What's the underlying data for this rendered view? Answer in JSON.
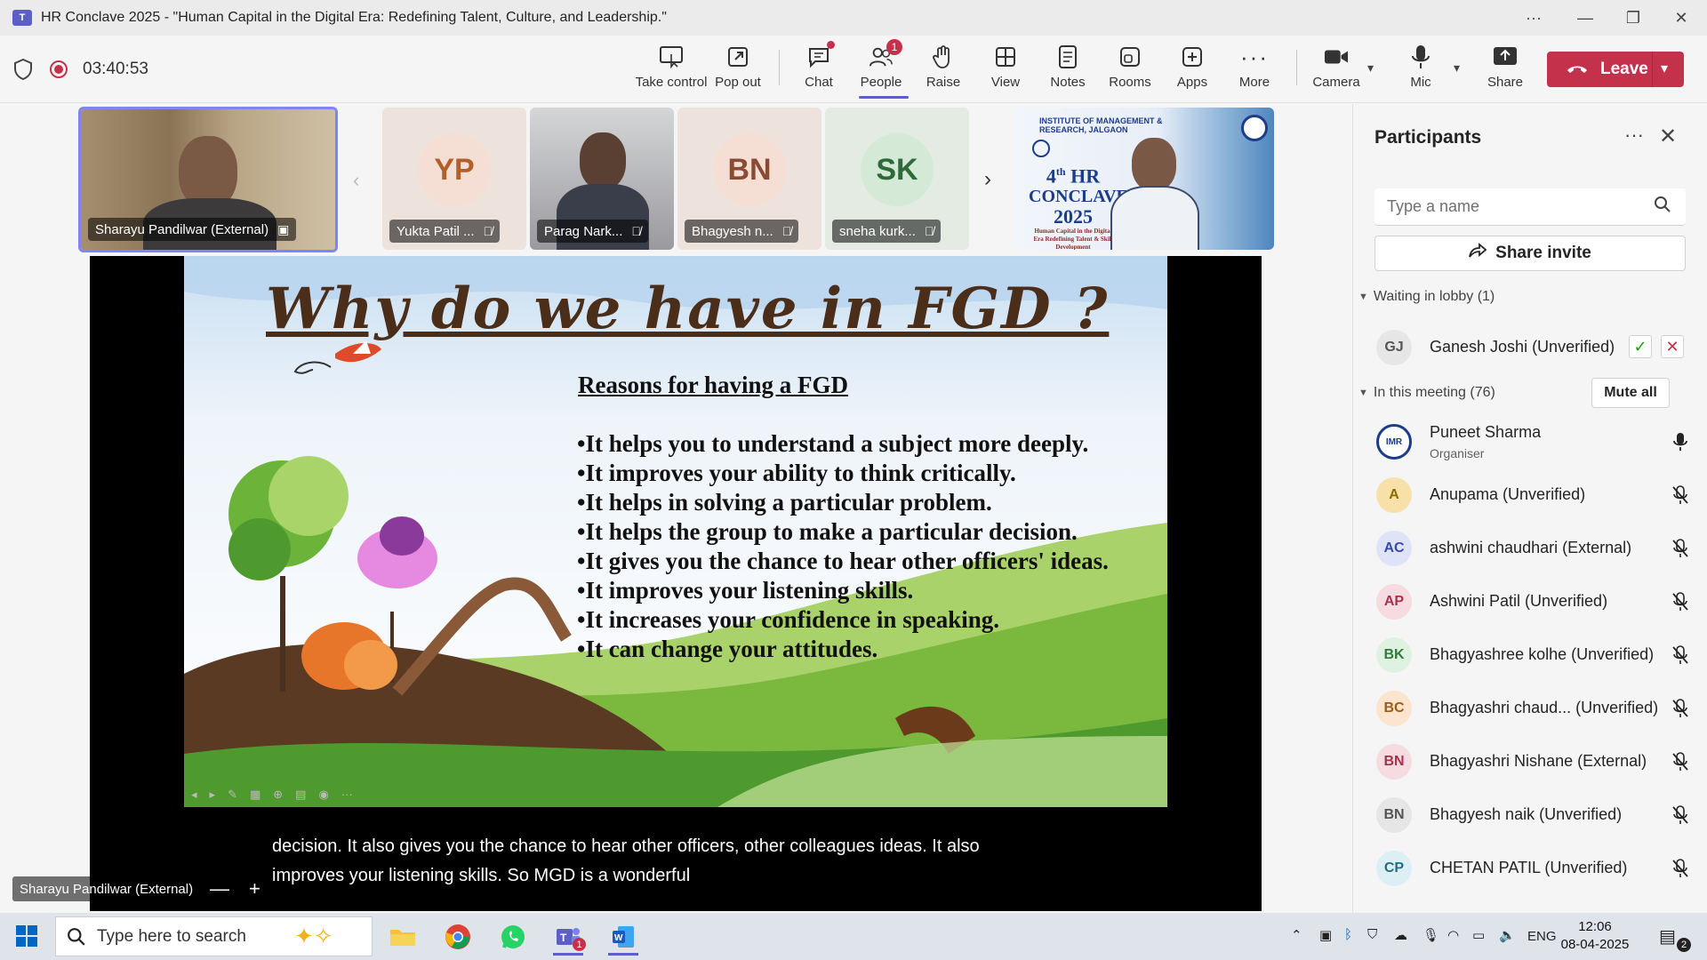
{
  "window": {
    "title": "HR Conclave 2025 - \"Human Capital in the Digital Era: Redefining Talent, Culture, and Leadership.\""
  },
  "meeting": {
    "timer": "03:40:53",
    "toolbar": [
      {
        "key": "take_control",
        "label": "Take control",
        "icon": "take-control-icon"
      },
      {
        "key": "pop_out",
        "label": "Pop out",
        "icon": "pop-out-icon"
      },
      {
        "key": "chat",
        "label": "Chat",
        "icon": "chat-icon"
      },
      {
        "key": "people",
        "label": "People",
        "icon": "people-icon",
        "badge": "1"
      },
      {
        "key": "raise",
        "label": "Raise",
        "icon": "hand-icon"
      },
      {
        "key": "view",
        "label": "View",
        "icon": "view-grid-icon"
      },
      {
        "key": "notes",
        "label": "Notes",
        "icon": "notes-icon"
      },
      {
        "key": "rooms",
        "label": "Rooms",
        "icon": "rooms-icon"
      },
      {
        "key": "apps",
        "label": "Apps",
        "icon": "apps-icon"
      },
      {
        "key": "more",
        "label": "More",
        "icon": "more-icon"
      },
      {
        "key": "camera",
        "label": "Camera",
        "icon": "camera-icon"
      },
      {
        "key": "mic",
        "label": "Mic",
        "icon": "mic-icon"
      },
      {
        "key": "share",
        "label": "Share",
        "icon": "share-icon"
      }
    ],
    "leave_label": "Leave"
  },
  "tiles": [
    {
      "name": "Sharayu Pandilwar (External)",
      "type": "video"
    },
    {
      "name": "Yukta Patil ...",
      "initials": "YP",
      "muted": true
    },
    {
      "name": "Parag Nark...",
      "type": "video",
      "muted": true
    },
    {
      "name": "Bhagyesh n...",
      "initials": "BN",
      "muted": true
    },
    {
      "name": "sneha kurk...",
      "initials": "SK",
      "muted": true
    }
  ],
  "conclave_banner": {
    "institute": "INSTITUTE OF MANAGEMENT & RESEARCH, JALGAON",
    "line1": "4",
    "line1_sup": "th",
    "line1_rest": " HR",
    "line2": "CONCLAVE",
    "line3": "2025",
    "tagline": "Human Capital in the Digital Era Redefining Talent & Skill Development"
  },
  "slide": {
    "title": "Why do we have in FGD ?",
    "subtitle": "Reasons for having a FGD",
    "bullets": [
      "•It helps you to understand a subject more deeply.",
      "•It improves your ability to think critically.",
      "•It helps in solving a particular problem.",
      "•It helps the group to make a particular decision.",
      "•It gives you the chance to hear other officers' ideas.",
      "•It improves your listening skills.",
      "•It increases your confidence in speaking.",
      "•It can change your attitudes."
    ]
  },
  "caption": {
    "line1": "decision. It also gives you the chance to hear other officers, other colleagues ideas. It also",
    "line2": "improves your listening skills. So MGD is a wonderful"
  },
  "stage": {
    "speaker_label": "Sharayu Pandilwar (External)",
    "zoom_out": "—",
    "zoom_in": "+"
  },
  "participants": {
    "title": "Participants",
    "search_placeholder": "Type a name",
    "share_invite": "Share invite",
    "lobby_label": "Waiting in lobby (1)",
    "lobby": [
      {
        "initials": "GJ",
        "name": "Ganesh Joshi (Unverified)"
      }
    ],
    "meeting_label": "In this meeting (76)",
    "mute_all": "Mute all",
    "list": [
      {
        "initials": "IMR",
        "name": "Puneet Sharma",
        "role": "Organiser",
        "mic": "on"
      },
      {
        "initials": "A",
        "name": "Anupama (Unverified)",
        "mic": "off",
        "color": "#f7e1a8",
        "fg": "#8a6d00"
      },
      {
        "initials": "AC",
        "name": "ashwini chaudhari (External)",
        "mic": "off",
        "color": "#dfe3f7",
        "fg": "#3a4aa8"
      },
      {
        "initials": "AP",
        "name": "Ashwini Patil (Unverified)",
        "mic": "off",
        "color": "#f6dbe0",
        "fg": "#a3344d"
      },
      {
        "initials": "BK",
        "name": "Bhagyashree kolhe (Unverified)",
        "mic": "off",
        "color": "#dff2e1",
        "fg": "#2e7d3a"
      },
      {
        "initials": "BC",
        "name": "Bhagyashri chaud...   (Unverified)",
        "mic": "off",
        "color": "#fbe5cf",
        "fg": "#a35a13"
      },
      {
        "initials": "BN",
        "name": "Bhagyashri Nishane (External)",
        "mic": "off",
        "color": "#f6dbe0",
        "fg": "#a3344d"
      },
      {
        "initials": "BN",
        "name": "Bhagyesh naik (Unverified)",
        "mic": "off",
        "color": "#e6e6e6",
        "fg": "#555555"
      },
      {
        "initials": "CP",
        "name": "CHETAN PATIL (Unverified)",
        "mic": "off",
        "color": "#dceff5",
        "fg": "#1f6e8a"
      }
    ]
  },
  "taskbar": {
    "search_placeholder": "Type here to search",
    "teams_badge": "1",
    "lang": "ENG",
    "time": "12:06",
    "date": "08-04-2025",
    "notifications": "2"
  }
}
